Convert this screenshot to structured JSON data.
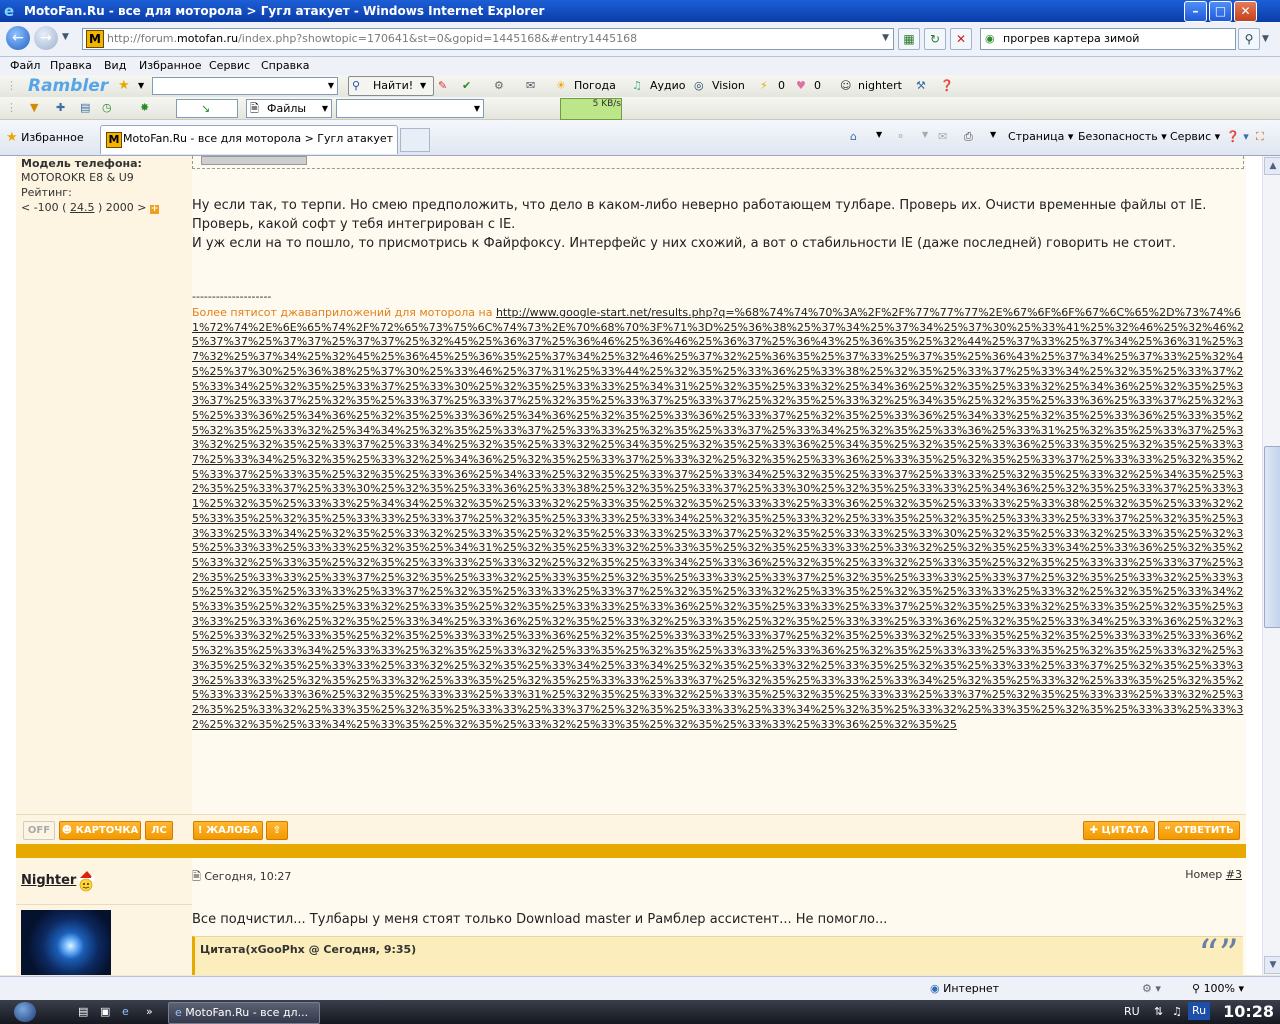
{
  "window": {
    "title": "MotoFan.Ru - все для моторола > Гугл атакует - Windows Internet Explorer",
    "minimize": "–",
    "maximize": "□",
    "close": "✕"
  },
  "address": {
    "url_prefix": "http://forum.",
    "url_domain": "motofan.ru",
    "url_suffix": "/index.php?showtopic=170641&st=0&gopid=1445168&#entry1445168",
    "logo": "M"
  },
  "search": {
    "value": "прогрев картера зимой"
  },
  "menu": [
    "Файл",
    "Правка",
    "Вид",
    "Избранное",
    "Сервис",
    "Справка"
  ],
  "rambler": {
    "logo": "Rambler",
    "find_button": "Найти!",
    "weather": "Погода",
    "audio": "Аудио",
    "vision": "Vision",
    "count1": "0",
    "count2": "0",
    "user": "nightert"
  },
  "toolbar2": {
    "files": "Файлы",
    "speed": "5 KB/s"
  },
  "tabs": {
    "favorites": "Избранное",
    "active_tab": "MotoFan.Ru - все для моторола > Гугл атакует",
    "commands": [
      "Страница",
      "Безопасность",
      "Сервис"
    ]
  },
  "post1": {
    "phone_label": "Модель телефона:",
    "phone_value": "MOTOROKR E8 & U9",
    "rating_label": "Рейтинг:",
    "rating_prefix": "< -100 (",
    "rating_value": "24.5",
    "rating_suffix": ") 2000 >",
    "rating_plus": "+",
    "message_line1": "Ну если так, то терпи. Но смею предположить, что дело в каком-либо неверно работающем тулбаре. Проверь их. Очисти временные файлы от IE. Проверь, какой софт у тебя интегрирован с IE.",
    "message_line2": "И уж если на то пошло, то присмотрись к Файрфоксу. Интерфейс у них схожий, а вот о стабильности IE (даже последней) говорить не стоит.",
    "sig_separator": "--------------------",
    "sig_lead": "Более пятисот джаваприложений для моторола на ",
    "sig_link": "http://www.google-start.net/results.php?q=%68%74%74%70%3A%2F%2F%77%77%77%2E%67%6F%6F%67%6C%65%2D%73%74%61%72%74%2E%6E%65%74%2F%72%65%73%75%6C%74%73%2E%70%68%70%3F%71%3D%25%36%38%25%37%34%25%37%34%25%37%30%25%33%41%25%32%46%25%32%46%25%37%37%25%37%37%25%37%37%25%32%45%25%36%37%25%36%46%25%36%46%25%36%37%25%36%43%25%36%35%25%32%44%25%37%33%25%37%34%25%36%31%25%37%32%25%37%34%25%32%45%25%36%45%25%36%35%25%37%34%25%32%46%25%37%32%25%36%35%25%37%33%25%37%35%25%36%43%25%37%34%25%37%33%25%32%45%25%37%30%25%36%38%25%37%30%25%33%46%25%37%31%25%33%44%25%32%35%25%33%36%25%33%38%25%32%35%25%33%37%25%33%34%25%32%35%25%33%37%25%33%34%25%32%35%25%33%37%25%33%30%25%32%35%25%33%33%25%34%31%25%32%35%25%33%32%25%34%36%25%32%35%25%33%32%25%34%36%25%32%35%25%33%37%25%33%37%25%32%35%25%33%37%25%33%37%25%32%35%25%33%37%25%33%37%25%32%35%25%33%32%25%34%35%25%32%35%25%33%36%25%33%37%25%32%35%25%33%36%25%34%36%25%32%35%25%33%36%25%34%36%25%32%35%25%33%36%25%33%37%25%32%35%25%33%36%25%34%33%25%32%35%25%33%36%25%33%35%25%32%35%25%33%32%25%34%34%25%32%35%25%33%37%25%33%33%25%32%35%25%33%37%25%33%34%25%32%35%25%33%36%25%33%31%25%32%35%25%33%37%25%33%32%25%32%35%25%33%37%25%33%34%25%32%35%25%33%32%25%34%35%25%32%35%25%33%36%25%34%35%25%32%35%25%33%36%25%33%35%25%32%35%25%33%37%25%33%34%25%32%35%25%33%32%25%34%36%25%32%35%25%33%37%25%33%32%25%32%35%25%33%36%25%33%35%25%32%35%25%33%37%25%33%33%25%32%35%25%33%37%25%33%35%25%32%35%25%33%36%25%34%33%25%32%35%25%33%37%25%33%34%25%32%35%25%33%37%25%33%33%25%32%35%25%33%32%25%34%35%25%32%35%25%33%37%25%33%30%25%32%35%25%33%36%25%33%38%25%32%35%25%33%37%25%33%30%25%32%35%25%33%33%25%34%36%25%32%35%25%33%37%25%33%31%25%32%35%25%33%33%25%34%34%25%32%35%25%33%32%25%33%35%25%32%35%25%33%33%25%33%36%25%32%35%25%33%33%25%33%38%25%32%35%25%33%32%25%33%35%25%32%35%25%33%33%25%33%37%25%32%35%25%33%33%25%33%34%25%32%35%25%33%32%25%33%35%25%32%35%25%33%33%25%33%37%25%32%35%25%33%33%25%33%34%25%32%35%25%33%32%25%33%35%25%32%35%25%33%33%25%33%37%25%32%35%25%33%33%25%33%30%25%32%35%25%33%32%25%33%35%25%32%35%25%33%33%25%33%33%25%32%35%25%34%31%25%32%35%25%33%32%25%33%35%25%32%35%25%33%33%25%33%32%25%32%35%25%33%34%25%33%36%25%32%35%25%33%32%25%33%35%25%32%35%25%33%33%25%33%32%25%32%35%25%33%34%25%33%36%25%32%35%25%33%32%25%33%35%25%32%35%25%33%33%25%33%37%25%32%35%25%33%33%25%33%37%25%32%35%25%33%32%25%33%35%25%32%35%25%33%33%25%33%37%25%32%35%25%33%33%25%33%37%25%32%35%25%33%32%25%33%35%25%32%35%25%33%33%25%33%37%25%32%35%25%33%33%25%33%37%25%32%35%25%33%32%25%33%35%25%32%35%25%33%33%25%33%32%25%32%35%25%33%34%25%33%35%25%32%35%25%33%32%25%33%35%25%32%35%25%33%33%25%33%36%25%32%35%25%33%33%25%33%37%25%32%35%25%33%32%25%33%35%25%32%35%25%33%33%25%33%36%25%32%35%25%33%34%25%33%36%25%32%35%25%33%32%25%33%35%25%32%35%25%33%33%25%33%36%25%32%35%25%33%34%25%33%36%25%32%35%25%33%32%25%33%35%25%32%35%25%33%33%25%33%36%25%32%35%25%33%33%25%33%37%25%32%35%25%33%32%25%33%35%25%32%35%25%33%33%25%33%36%25%32%35%25%33%34%25%33%33%25%32%35%25%33%32%25%33%35%25%32%35%25%33%33%25%33%36%25%32%35%25%33%33%25%33%35%25%32%35%25%33%32%25%33%35%25%32%35%25%33%33%25%33%32%25%32%35%25%33%34%25%33%34%25%32%35%25%33%32%25%33%35%25%32%35%25%33%33%25%33%37%25%32%35%25%33%33%25%33%33%25%32%35%25%33%32%25%33%35%25%32%35%25%33%33%25%33%37%25%32%35%25%33%33%25%33%34%25%32%35%25%33%32%25%33%35%25%32%35%25%33%33%25%33%36%25%32%35%25%33%33%25%33%31%25%32%35%25%33%32%25%33%35%25%32%35%25%33%33%25%33%37%25%32%35%25%33%33%25%33%32%25%32%35%25%33%32%25%33%35%25%32%35%25%33%33%25%33%37%25%32%35%25%33%33%25%33%34%25%32%35%25%33%32%25%33%35%25%32%35%25%33%33%25%33%32%25%32%35%25%33%34%25%33%35%25%32%35%25%33%32%25%33%35%25%32%35%25%33%33%25%33%36%25%32%35%25"
  },
  "post1_actions": {
    "off": "OFF",
    "card": "КАРТОЧКА",
    "pm": "ЛС",
    "report": "ЖАЛОБА",
    "quote": "ЦИТАТА",
    "reply": "ОТВЕТИТЬ"
  },
  "post2": {
    "author": "Nighter",
    "date": "Сегодня, 10:27",
    "number_label": "Номер",
    "number": "#3",
    "text": "Все подчистил... Тулбары у меня стоят только Download master и Рамблер ассистент... Не помогло...",
    "quote_header": "Цитата(xGooPhx @ Сегодня, 9:35)"
  },
  "status": {
    "zone": "Интернет",
    "zoom": "100%"
  },
  "taskbar": {
    "item": "MotoFan.Ru - все дл...",
    "lang1": "RU",
    "lang2": "Ru",
    "time": "10:28"
  }
}
